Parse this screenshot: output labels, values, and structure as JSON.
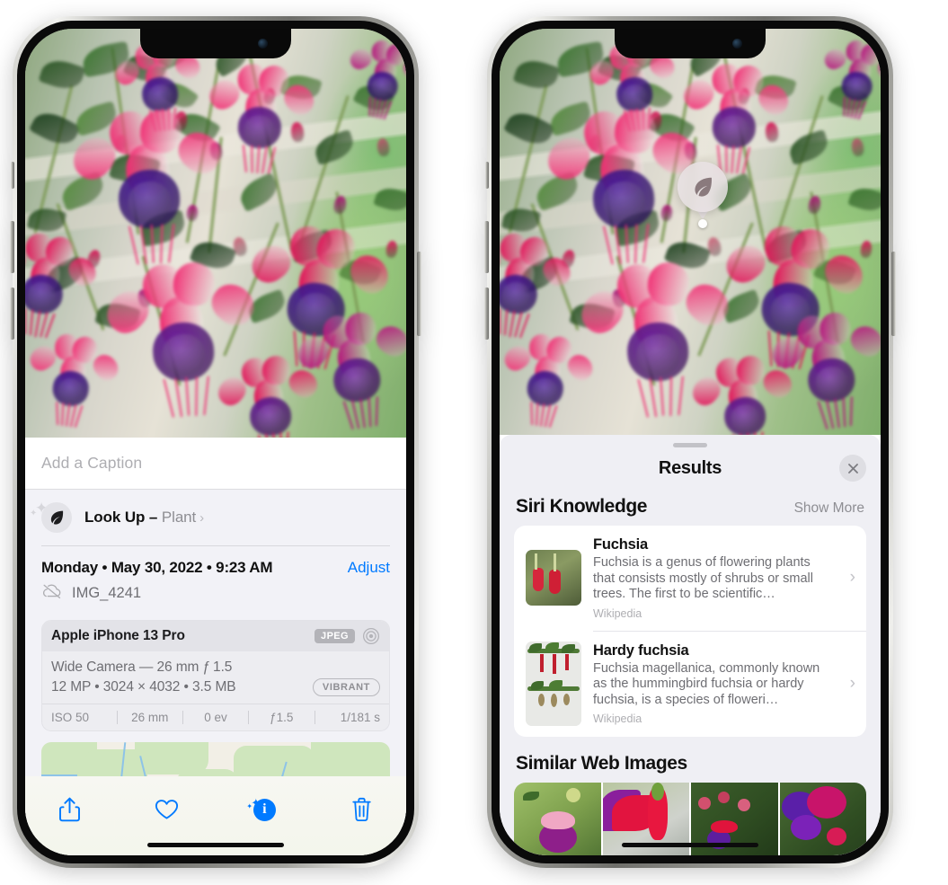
{
  "left_phone": {
    "name": "photos-detail-view",
    "caption": {
      "placeholder": "Add a Caption",
      "value": ""
    },
    "look_up": {
      "label": "Look Up – ",
      "subject": "Plant",
      "chevron": "›",
      "icon": "leaf-icon"
    },
    "date": "Monday • May 30, 2022 • 9:23 AM",
    "adjust_label": "Adjust",
    "file_name": "IMG_4241",
    "cloud_icon": "cloud-slash-icon",
    "exif": {
      "model": "Apple iPhone 13 Pro",
      "format_badge": "JPEG",
      "lens_icon": "camera-lens-icon",
      "lens_line": "Wide Camera — 26 mm ƒ 1.5",
      "size_line": "12 MP • 3024 × 4032 • 3.5 MB",
      "style_badge": "VIBRANT",
      "stats": [
        "ISO 50",
        "26 mm",
        "0 ev",
        "ƒ1.5",
        "1/181 s"
      ]
    },
    "toolbar": {
      "share_label": "share-icon",
      "favorite_label": "heart-icon",
      "info_label": "info-sparkle-icon",
      "delete_label": "trash-icon",
      "accent": "#007AFF"
    }
  },
  "right_phone": {
    "name": "visual-look-up-results",
    "badge": {
      "icon": "leaf-icon",
      "label": "visual-look-up-badge"
    },
    "sheet": {
      "title": "Results",
      "close_label": "×"
    },
    "siri_knowledge": {
      "title": "Siri Knowledge",
      "show_more": "Show More",
      "items": [
        {
          "title": "Fuchsia",
          "description": "Fuchsia is a genus of flowering plants that consists mostly of shrubs or small trees. The first to be scientific…",
          "source": "Wikipedia",
          "chevron": "›"
        },
        {
          "title": "Hardy fuchsia",
          "description": "Fuchsia magellanica, commonly known as the hummingbird fuchsia or hardy fuchsia, is a species of floweri…",
          "source": "Wikipedia",
          "chevron": "›"
        }
      ]
    },
    "similar_web_images": {
      "title": "Similar Web Images",
      "count": 4
    }
  },
  "colors": {
    "ios_blue": "#007AFF",
    "sheet_bg": "#EFEFF4",
    "card_bg": "#FFFFFF",
    "secondary_text": "#8E8E93"
  }
}
